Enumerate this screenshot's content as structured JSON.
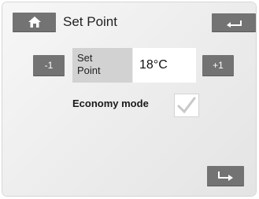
{
  "header": {
    "title": "Set Point",
    "home_icon": "home-icon",
    "back_icon": "back-arrow-icon"
  },
  "setpoint": {
    "label": "Set\nPoint",
    "value": "18°C",
    "decrement_label": "-1",
    "increment_label": "+1"
  },
  "economy": {
    "label": "Economy mode",
    "checked": true,
    "check_icon": "checkmark-icon"
  },
  "footer": {
    "enter_icon": "enter-arrow-icon"
  },
  "colors": {
    "button": "#737373",
    "label_background": "#d2d2d2",
    "check": "#c8c8c8"
  }
}
